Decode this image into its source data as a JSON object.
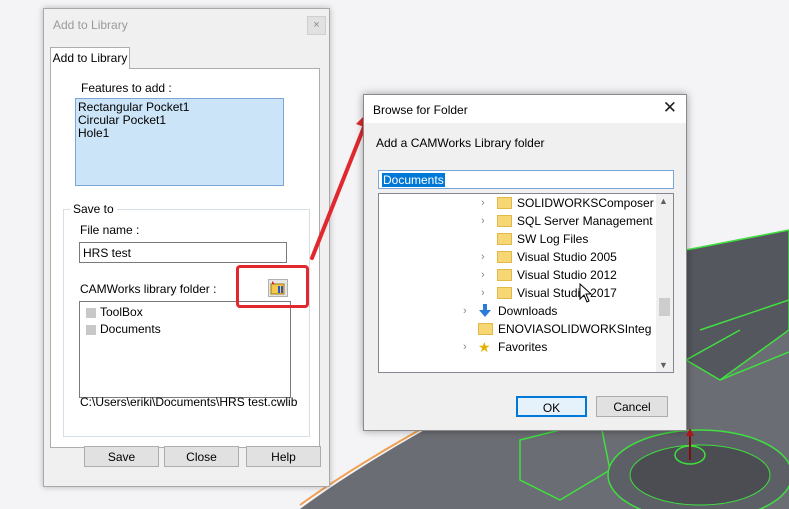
{
  "add_library": {
    "title": "Add to Library",
    "close_glyph": "×",
    "tab_label": "Add to Library",
    "features_label": "Features to add :",
    "features": [
      "Rectangular Pocket1",
      "Circular Pocket1",
      "Hole1"
    ],
    "save_to_label": "Save to",
    "file_name_label": "File name :",
    "file_name_value": "HRS test",
    "library_folder_label": "CAMWorks library folder :",
    "library_folders": [
      "ToolBox",
      "Documents"
    ],
    "path": "C:\\Users\\eriki\\Documents\\HRS test.cwlib",
    "buttons": {
      "save": "Save",
      "close": "Close",
      "help": "Help"
    }
  },
  "browse": {
    "title": "Browse for Folder",
    "close_glyph": "✕",
    "prompt": "Add a CAMWorks Library folder",
    "selected_folder": "Documents",
    "tree": [
      {
        "label": "SOLIDWORKSComposer",
        "icon": "folder-icon",
        "chevron": true
      },
      {
        "label": "SQL Server Management St",
        "icon": "folder-icon",
        "chevron": true
      },
      {
        "label": "SW Log Files",
        "icon": "folder-icon",
        "chevron": false
      },
      {
        "label": "Visual Studio 2005",
        "icon": "folder-icon",
        "chevron": true
      },
      {
        "label": "Visual Studio 2012",
        "icon": "folder-icon",
        "chevron": true
      },
      {
        "label": "Visual Studio 2017",
        "icon": "folder-icon",
        "chevron": true
      },
      {
        "label": "Downloads",
        "icon": "download-arrow-icon",
        "chevron": true
      },
      {
        "label": "ENOVIASOLIDWORKSInteg",
        "icon": "folder-icon",
        "chevron": false
      },
      {
        "label": "Favorites",
        "icon": "star-icon",
        "chevron": true
      }
    ],
    "buttons": {
      "ok": "OK",
      "cancel": "Cancel"
    }
  },
  "colors": {
    "highlight_red": "#e0282e",
    "selection_blue": "#0078d7",
    "model_green": "#3fe03f",
    "model_gray": "#6b6d74"
  }
}
